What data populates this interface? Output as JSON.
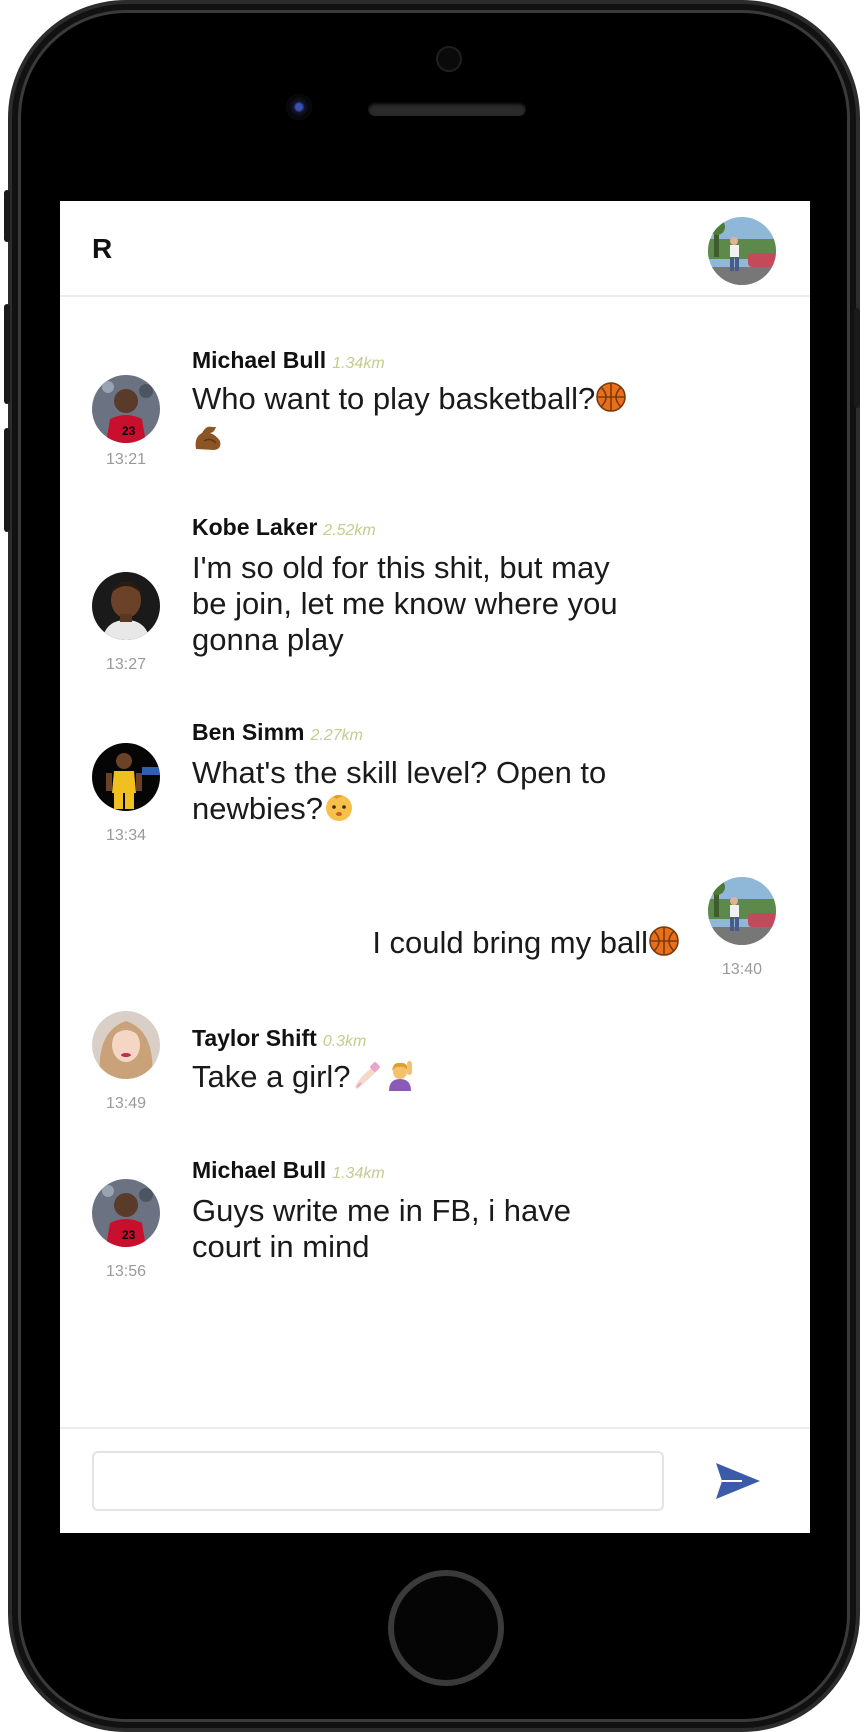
{
  "header": {
    "title": "R"
  },
  "messages": [
    {
      "name": "Michael Bull",
      "distance": "1.34km",
      "text": "Who want to play basketball?",
      "emojis": [
        "basketball",
        "flexed-biceps"
      ],
      "time": "13:21",
      "avatar": "michael-bull-avatar"
    },
    {
      "name": "Kobe Laker",
      "distance": "2.52km",
      "text": "I'm so old for this shit, but may be join, let me know where you gonna play",
      "emojis": [],
      "time": "13:27",
      "avatar": "kobe-laker-avatar"
    },
    {
      "name": "Ben Simm",
      "distance": "2.27km",
      "text": "What's the skill level? Open to newbies?",
      "emojis": [
        "baby-face"
      ],
      "time": "13:34",
      "avatar": "ben-simm-avatar"
    },
    {
      "self": true,
      "text": "I could bring my ball",
      "emojis": [
        "basketball"
      ],
      "time": "13:40",
      "avatar": "own-avatar"
    },
    {
      "name": "Taylor Shift",
      "distance": "0.3km",
      "text": "Take a girl?",
      "emojis": [
        "nail-polish",
        "person-raising-hand"
      ],
      "time": "13:49",
      "avatar": "taylor-shift-avatar"
    },
    {
      "name": "Michael Bull",
      "distance": "1.34km",
      "text": "Guys write me in FB, i have court in mind",
      "emojis": [],
      "time": "13:56",
      "avatar": "michael-bull-avatar"
    }
  ],
  "composer": {
    "placeholder": "",
    "send_icon": "send-icon"
  },
  "colors": {
    "distance": "#c4cc8e",
    "time": "#9a9a9a",
    "send": "#3b5ba8"
  }
}
